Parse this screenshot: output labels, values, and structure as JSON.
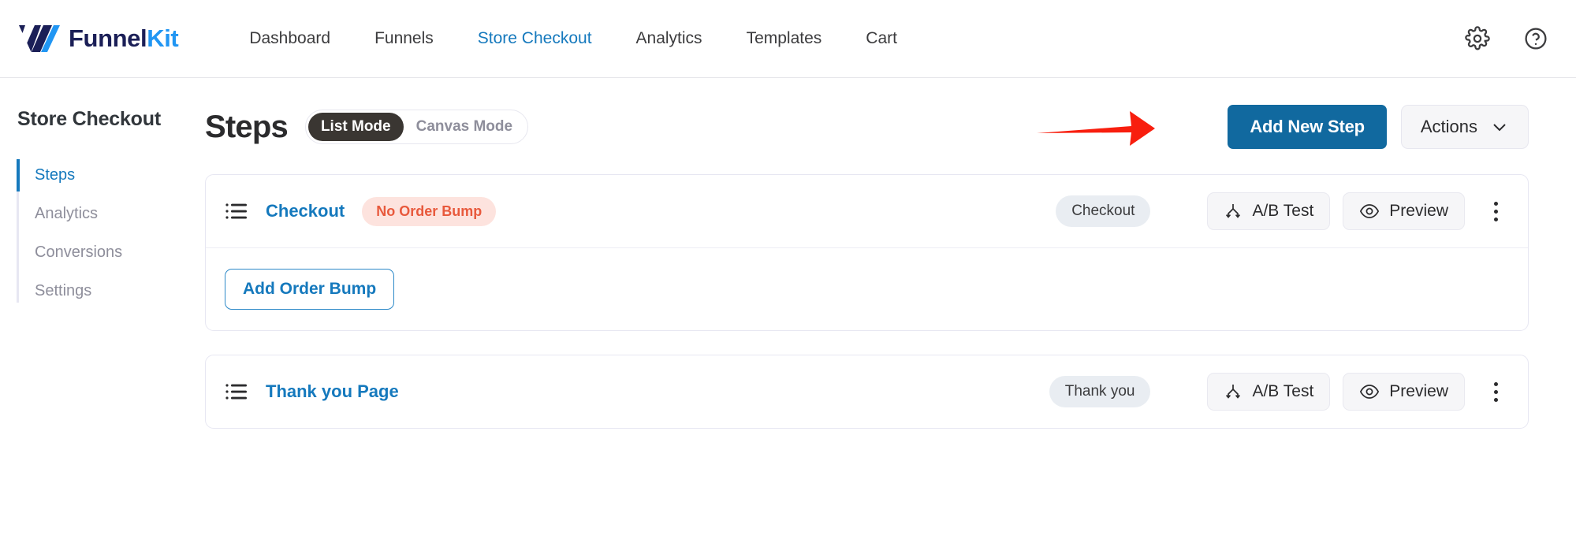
{
  "topbar": {
    "logo": {
      "part1": "Funnel",
      "part2": "Kit",
      "icon": "funnelkit-logo-mark"
    },
    "nav": [
      {
        "label": "Dashboard",
        "active": false
      },
      {
        "label": "Funnels",
        "active": false
      },
      {
        "label": "Store Checkout",
        "active": true
      },
      {
        "label": "Analytics",
        "active": false
      },
      {
        "label": "Templates",
        "active": false
      },
      {
        "label": "Cart",
        "active": false
      }
    ],
    "settings_icon": "gear-icon",
    "help_icon": "help-circle-icon"
  },
  "sidebar": {
    "title": "Store Checkout",
    "items": [
      {
        "label": "Steps",
        "active": true
      },
      {
        "label": "Analytics",
        "active": false
      },
      {
        "label": "Conversions",
        "active": false
      },
      {
        "label": "Settings",
        "active": false
      }
    ]
  },
  "main": {
    "page_title": "Steps",
    "mode_toggle": {
      "list_mode": "List Mode",
      "canvas_mode": "Canvas Mode",
      "selected": "List Mode"
    },
    "add_new_step": "Add New Step",
    "actions": "Actions",
    "actions_chevron": "chevron-down-icon",
    "annotation_arrow": "red-arrow-pointing-to-add-new-step"
  },
  "steps": [
    {
      "name": "Checkout",
      "icon": "list-lines-icon",
      "warning_badge": "No Order Bump",
      "type_badge": "Checkout",
      "ab_test": "A/B Test",
      "ab_test_icon": "split-branch-icon",
      "preview": "Preview",
      "preview_icon": "eye-icon",
      "menu_icon": "kebab-menu-icon",
      "order_bump": {
        "add_label": "Add Order Bump"
      }
    },
    {
      "name": "Thank you Page",
      "icon": "list-lines-icon",
      "warning_badge": null,
      "type_badge": "Thank you",
      "ab_test": "A/B Test",
      "ab_test_icon": "split-branch-icon",
      "preview": "Preview",
      "preview_icon": "eye-icon",
      "menu_icon": "kebab-menu-icon",
      "order_bump": null
    }
  ],
  "colors": {
    "brand_blue": "#1579bd",
    "primary_button": "#11699f",
    "logo_navy": "#1b1f57",
    "logo_blue": "#2196f3",
    "warning_badge_bg": "#fde3de",
    "warning_badge_text": "#e8593c",
    "annotation_red": "#f81e0e",
    "toggle_active_bg": "#3a3632"
  }
}
